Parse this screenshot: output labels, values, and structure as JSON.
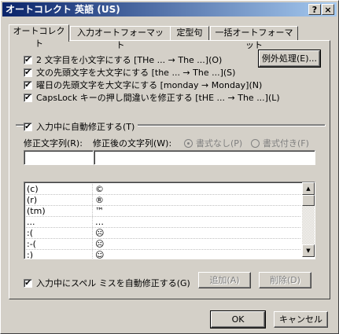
{
  "window": {
    "title": "オートコレクト 英語 (US)",
    "help_button": "?",
    "close_button": "×"
  },
  "tabs": [
    {
      "label": "オートコレクト"
    },
    {
      "label": "入力オートフォーマット"
    },
    {
      "label": "定型句"
    },
    {
      "label": "一括オートフォーマット"
    }
  ],
  "options": [
    {
      "label": "2 文字目を小文字にする [THe ... → The ...](O)",
      "checked": true
    },
    {
      "label": "文の先頭文字を大文字にする [the ... → The ...](S)",
      "checked": true
    },
    {
      "label": "曜日の先頭文字を大文字にする [monday →  Monday](N)",
      "checked": true
    },
    {
      "label": "CapsLock キーの押し間違いを修正する [tHE ... → The ...](L)",
      "checked": true
    }
  ],
  "exceptions_button": "例外処理(E)...",
  "autoreplace": {
    "label": "入力中に自動修正する(T)",
    "checked": true,
    "replace_label": "修正文字列(R):",
    "with_label": "修正後の文字列(W):",
    "replace_value": "",
    "with_value": "",
    "plain_text_label": "書式なし(P)",
    "formatted_text_label": "書式付き(F)",
    "plain_text_selected": true
  },
  "entries": [
    {
      "from": "(c)",
      "to": "©"
    },
    {
      "from": "(r)",
      "to": "®"
    },
    {
      "from": "(tm)",
      "to": "™"
    },
    {
      "from": "...",
      "to": "…"
    },
    {
      "from": ":(",
      "to": "☹"
    },
    {
      "from": ":-(",
      "to": "☹"
    },
    {
      "from": ":)",
      "to": "☺"
    }
  ],
  "spelling": {
    "label": "入力中にスペル ミスを自動修正する(G)",
    "checked": true
  },
  "add_button": "追加(A)",
  "delete_button": "削除(D)",
  "ok_button": "OK",
  "cancel_button": "キャンセル",
  "check_mark": "✔",
  "scroll_up": "▲",
  "scroll_down": "▼"
}
